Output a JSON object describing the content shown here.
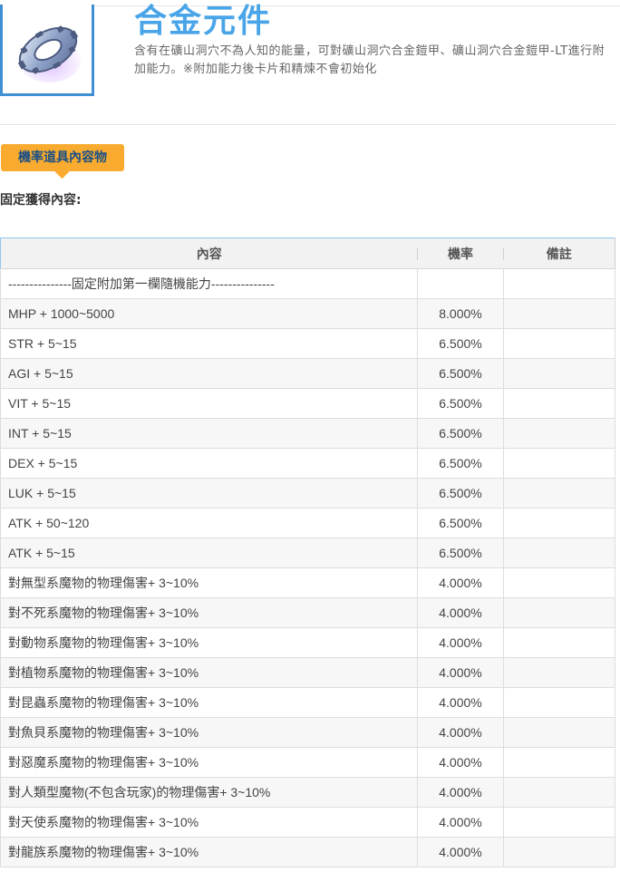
{
  "item": {
    "title": "合金元件",
    "description": "含有在礦山洞穴不為人知的能量，可對礦山洞穴合金鎧甲、礦山洞穴合金鎧甲-LT進行附加能力。※附加能力後卡片和精煉不會初始化",
    "image_icon": "alloy-gear-icon"
  },
  "section": {
    "tag_label": "機率道具內容物",
    "fixed_label": "固定獲得內容:"
  },
  "table": {
    "headers": [
      "內容",
      "機率",
      "備註"
    ],
    "rows": [
      {
        "content": "---------------固定附加第一欄隨機能力---------------",
        "rate": "",
        "note": ""
      },
      {
        "content": "MHP + 1000~5000",
        "rate": "8.000%",
        "note": ""
      },
      {
        "content": "STR + 5~15",
        "rate": "6.500%",
        "note": ""
      },
      {
        "content": "AGI + 5~15",
        "rate": "6.500%",
        "note": ""
      },
      {
        "content": "VIT + 5~15",
        "rate": "6.500%",
        "note": ""
      },
      {
        "content": "INT + 5~15",
        "rate": "6.500%",
        "note": ""
      },
      {
        "content": "DEX + 5~15",
        "rate": "6.500%",
        "note": ""
      },
      {
        "content": "LUK + 5~15",
        "rate": "6.500%",
        "note": ""
      },
      {
        "content": "ATK + 50~120",
        "rate": "6.500%",
        "note": ""
      },
      {
        "content": "ATK + 5~15",
        "rate": "6.500%",
        "note": ""
      },
      {
        "content": "對無型系魔物的物理傷害+ 3~10%",
        "rate": "4.000%",
        "note": ""
      },
      {
        "content": "對不死系魔物的物理傷害+ 3~10%",
        "rate": "4.000%",
        "note": ""
      },
      {
        "content": "對動物系魔物的物理傷害+ 3~10%",
        "rate": "4.000%",
        "note": ""
      },
      {
        "content": "對植物系魔物的物理傷害+ 3~10%",
        "rate": "4.000%",
        "note": ""
      },
      {
        "content": "對昆蟲系魔物的物理傷害+ 3~10%",
        "rate": "4.000%",
        "note": ""
      },
      {
        "content": "對魚貝系魔物的物理傷害+ 3~10%",
        "rate": "4.000%",
        "note": ""
      },
      {
        "content": "對惡魔系魔物的物理傷害+ 3~10%",
        "rate": "4.000%",
        "note": ""
      },
      {
        "content": "對人類型魔物(不包含玩家)的物理傷害+ 3~10%",
        "rate": "4.000%",
        "note": ""
      },
      {
        "content": "對天使系魔物的物理傷害+ 3~10%",
        "rate": "4.000%",
        "note": ""
      },
      {
        "content": "對龍族系魔物的物理傷害+ 3~10%",
        "rate": "4.000%",
        "note": ""
      }
    ]
  }
}
